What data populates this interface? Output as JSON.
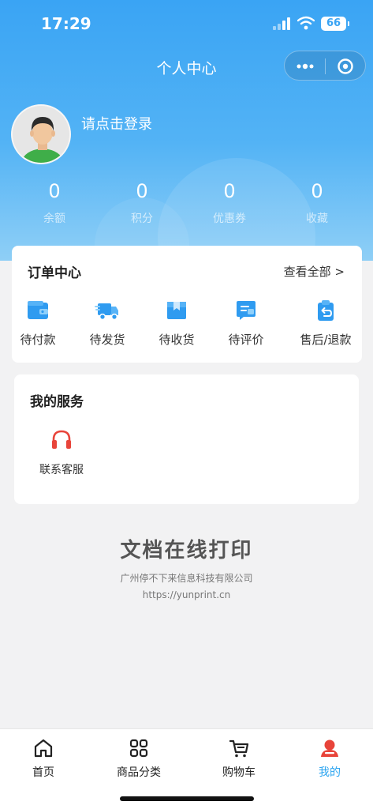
{
  "status_bar": {
    "time": "17:29",
    "battery": "66"
  },
  "nav": {
    "title": "个人中心"
  },
  "profile": {
    "login_prompt": "请点击登录"
  },
  "stats": [
    {
      "value": "0",
      "label": "余额"
    },
    {
      "value": "0",
      "label": "积分"
    },
    {
      "value": "0",
      "label": "优惠券"
    },
    {
      "value": "0",
      "label": "收藏"
    }
  ],
  "orders": {
    "title": "订单中心",
    "view_all": "查看全部 >",
    "items": [
      {
        "label": "待付款",
        "icon": "wallet-icon"
      },
      {
        "label": "待发货",
        "icon": "truck-icon"
      },
      {
        "label": "待收货",
        "icon": "package-icon"
      },
      {
        "label": "待评价",
        "icon": "review-icon"
      },
      {
        "label": "售后/退款",
        "icon": "refund-icon"
      }
    ]
  },
  "services": {
    "title": "我的服务",
    "items": [
      {
        "label": "联系客服",
        "icon": "headset-icon"
      }
    ]
  },
  "brand": {
    "title": "文档在线打印",
    "company": "广州停不下来信息科技有限公司",
    "url": "https://yunprint.cn"
  },
  "tabbar": [
    {
      "label": "首页",
      "icon": "home-icon"
    },
    {
      "label": "商品分类",
      "icon": "grid-icon"
    },
    {
      "label": "购物车",
      "icon": "cart-icon"
    },
    {
      "label": "我的",
      "icon": "user-icon",
      "active": true
    }
  ],
  "colors": {
    "accent": "#2aa4f0",
    "header": "#3aa4f4",
    "headset": "#e8443a"
  }
}
